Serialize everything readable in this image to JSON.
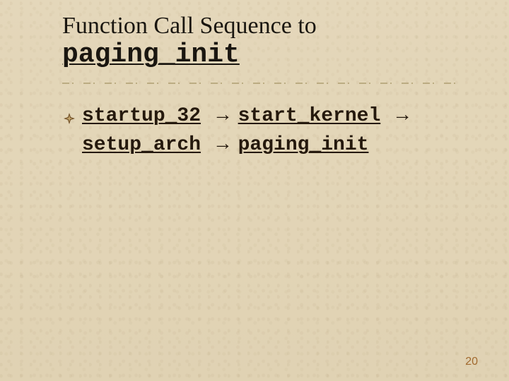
{
  "title": {
    "line1": "Function Call Sequence to",
    "line2": "paging_init"
  },
  "bullet": {
    "fn1": "startup_32",
    "fn2": "start_kernel",
    "fn3": "setup_arch",
    "fn4": "paging_init",
    "arrow": "→"
  },
  "page_number": "20",
  "colors": {
    "background": "#e3d6b8",
    "text": "#1a1610",
    "accent": "#a1692e"
  }
}
